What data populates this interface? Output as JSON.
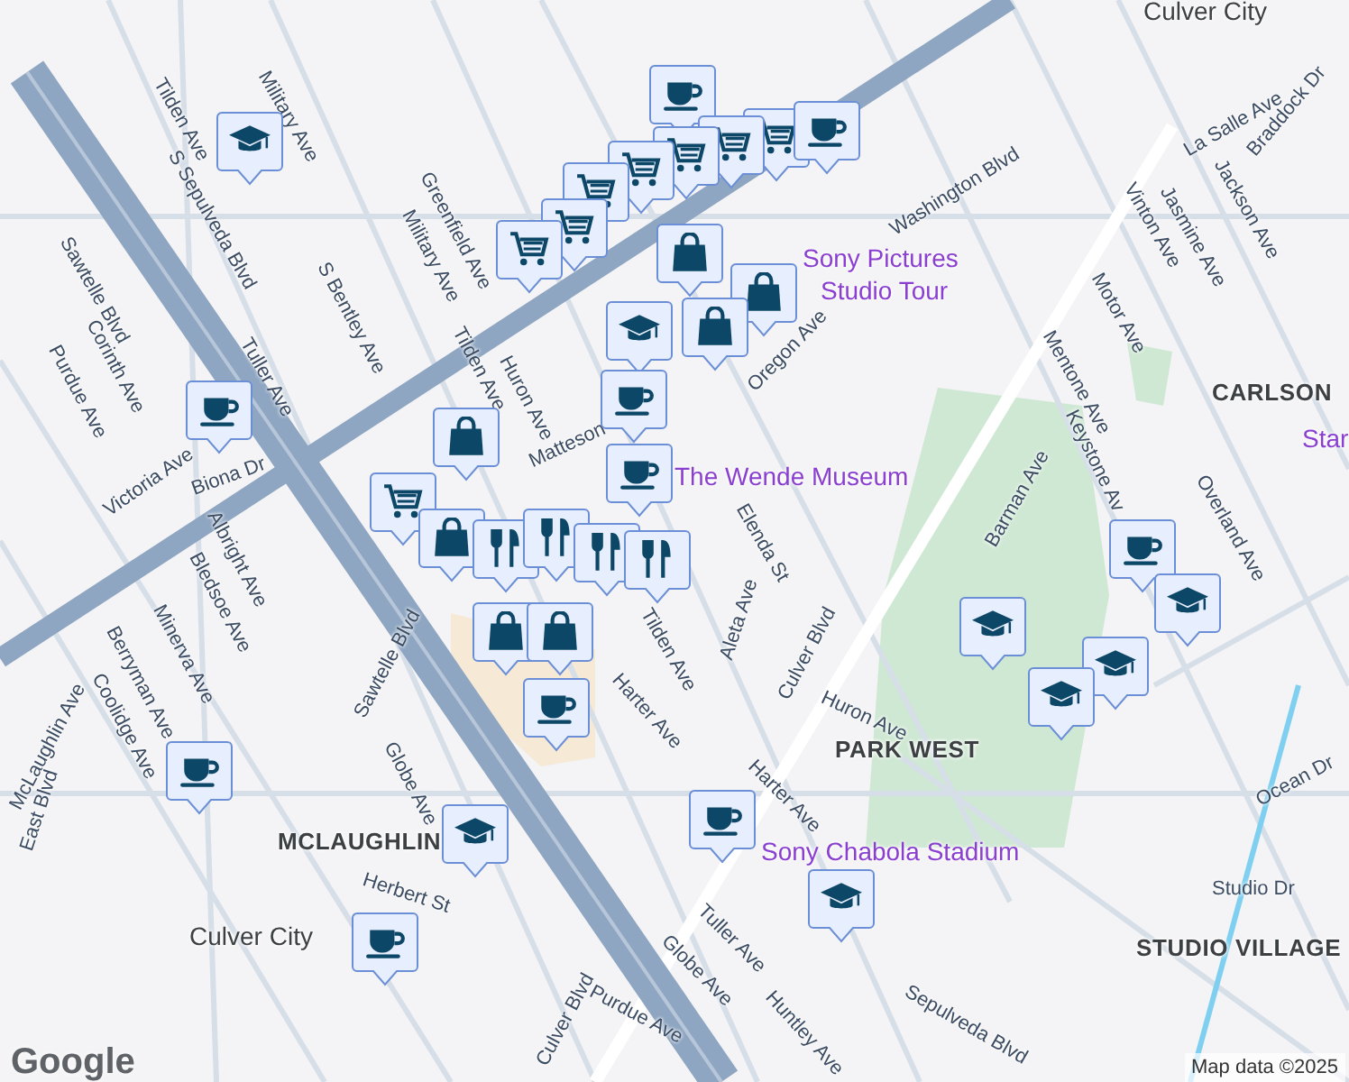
{
  "map": {
    "labels": [
      {
        "kind": "place",
        "text": "Culver City"
      },
      {
        "kind": "street",
        "text": "Military Ave"
      },
      {
        "kind": "street",
        "text": "Tilden Ave"
      },
      {
        "kind": "street",
        "text": "Braddock Dr"
      },
      {
        "kind": "street",
        "text": "La Salle Ave"
      },
      {
        "kind": "street",
        "text": "S Sepulveda Blvd"
      },
      {
        "kind": "street",
        "text": "Jackson Ave"
      },
      {
        "kind": "street",
        "text": "Greenfield Ave"
      },
      {
        "kind": "street",
        "text": "Vinton Ave"
      },
      {
        "kind": "street",
        "text": "Jasmine Ave"
      },
      {
        "kind": "street",
        "text": "Washington Blvd"
      },
      {
        "kind": "street",
        "text": "Military Ave"
      },
      {
        "kind": "street",
        "text": "Sawtelle Blvd"
      },
      {
        "kind": "poi",
        "text": "Sony Pictures"
      },
      {
        "kind": "street",
        "text": "S Bentley Ave"
      },
      {
        "kind": "poi",
        "text": "Studio Tour"
      },
      {
        "kind": "street",
        "text": "Motor Ave"
      },
      {
        "kind": "street",
        "text": "Corinth Ave"
      },
      {
        "kind": "street",
        "text": "Tilden Ave"
      },
      {
        "kind": "street",
        "text": "Mentone Ave"
      },
      {
        "kind": "street",
        "text": "Tuller Ave"
      },
      {
        "kind": "street",
        "text": "Purdue Ave"
      },
      {
        "kind": "street",
        "text": "Huron Ave"
      },
      {
        "kind": "street",
        "text": "Oregon Ave"
      },
      {
        "kind": "place",
        "text": "CARLSON"
      },
      {
        "kind": "street",
        "text": "Matteson"
      },
      {
        "kind": "poi",
        "text": "Star"
      },
      {
        "kind": "street",
        "text": "Victoria Ave"
      },
      {
        "kind": "poi",
        "text": "The Wende Museum"
      },
      {
        "kind": "street",
        "text": "Biona Dr"
      },
      {
        "kind": "street",
        "text": "Keystone Av"
      },
      {
        "kind": "street",
        "text": "Overland Ave"
      },
      {
        "kind": "street",
        "text": "Elenda St"
      },
      {
        "kind": "street",
        "text": "Albright Ave"
      },
      {
        "kind": "street",
        "text": "Barman Ave"
      },
      {
        "kind": "street",
        "text": "Bledsoe Ave"
      },
      {
        "kind": "street",
        "text": "Minerva Ave"
      },
      {
        "kind": "street",
        "text": "Tilden Ave"
      },
      {
        "kind": "street",
        "text": "Berryman Ave"
      },
      {
        "kind": "street",
        "text": "Aleta Ave"
      },
      {
        "kind": "street",
        "text": "Harter Ave"
      },
      {
        "kind": "street",
        "text": "Coolidge Ave"
      },
      {
        "kind": "street",
        "text": "Culver Blvd"
      },
      {
        "kind": "street",
        "text": "Huron Ave"
      },
      {
        "kind": "street",
        "text": "Sawtelle Blvd"
      },
      {
        "kind": "place",
        "text": "PARK WEST"
      },
      {
        "kind": "street",
        "text": "McLaughlin Ave"
      },
      {
        "kind": "street",
        "text": "Globe Ave"
      },
      {
        "kind": "street",
        "text": "Harter Ave"
      },
      {
        "kind": "street",
        "text": "Ocean Dr"
      },
      {
        "kind": "place",
        "text": "MCLAUGHLIN"
      },
      {
        "kind": "street",
        "text": "East Blvd"
      },
      {
        "kind": "poi",
        "text": "Sony Chabola Stadium"
      },
      {
        "kind": "street",
        "text": "Herbert St"
      },
      {
        "kind": "street",
        "text": "Studio Dr"
      },
      {
        "kind": "street",
        "text": "Tuller Ave"
      },
      {
        "kind": "place",
        "text": "Culver City"
      },
      {
        "kind": "street",
        "text": "Globe Ave"
      },
      {
        "kind": "place",
        "text": "STUDIO VILLAGE"
      },
      {
        "kind": "street",
        "text": "Purdue Ave"
      },
      {
        "kind": "street",
        "text": "Huntley Ave"
      },
      {
        "kind": "street",
        "text": "Sepulveda Blvd"
      },
      {
        "kind": "street",
        "text": "Culver Blvd"
      }
    ],
    "markers": [
      {
        "kind": "cap"
      },
      {
        "kind": "coffee"
      },
      {
        "kind": "cart"
      },
      {
        "kind": "cart"
      },
      {
        "kind": "cart"
      },
      {
        "kind": "cart"
      },
      {
        "kind": "cart"
      },
      {
        "kind": "cart"
      },
      {
        "kind": "cart"
      },
      {
        "kind": "coffee"
      },
      {
        "kind": "bag"
      },
      {
        "kind": "bag"
      },
      {
        "kind": "cap"
      },
      {
        "kind": "bag"
      },
      {
        "kind": "coffee"
      },
      {
        "kind": "coffee"
      },
      {
        "kind": "bag"
      },
      {
        "kind": "cart"
      },
      {
        "kind": "bag"
      },
      {
        "kind": "utensils"
      },
      {
        "kind": "utensils"
      },
      {
        "kind": "utensils"
      },
      {
        "kind": "utensils"
      },
      {
        "kind": "bag"
      },
      {
        "kind": "bag"
      },
      {
        "kind": "coffee"
      },
      {
        "kind": "coffee"
      },
      {
        "kind": "coffee"
      },
      {
        "kind": "cap"
      },
      {
        "kind": "coffee"
      },
      {
        "kind": "coffee"
      },
      {
        "kind": "cap"
      },
      {
        "kind": "coffee"
      },
      {
        "kind": "cap"
      },
      {
        "kind": "cap"
      },
      {
        "kind": "cap"
      },
      {
        "kind": "cap"
      }
    ]
  },
  "logo": "Google",
  "attribution": "Map data ©2025"
}
